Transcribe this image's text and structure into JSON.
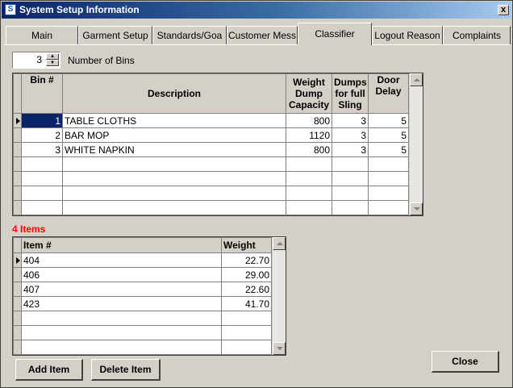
{
  "window": {
    "title": "System Setup Information",
    "app_icon": "S",
    "close_glyph": "x"
  },
  "tabs": [
    {
      "label": "Main",
      "active": false
    },
    {
      "label": "Garment Setup",
      "active": false
    },
    {
      "label": "Standards/Goa",
      "active": false
    },
    {
      "label": "Customer Mess",
      "active": false
    },
    {
      "label": "Classifier",
      "active": true
    },
    {
      "label": "Logout Reason",
      "active": false
    },
    {
      "label": "Complaints",
      "active": false
    }
  ],
  "bins": {
    "count": "3",
    "label": "Number of Bins"
  },
  "bin_table": {
    "headers": {
      "bin": "Bin #",
      "description": "Description",
      "weight": "Weight Dump Capacity",
      "dumps": "Dumps for full Sling",
      "delay": "Door Delay"
    },
    "rows": [
      {
        "bin": "1",
        "description": "TABLE CLOTHS",
        "weight": "800",
        "dumps": "3",
        "delay": "5"
      },
      {
        "bin": "2",
        "description": "BAR MOP",
        "weight": "1120",
        "dumps": "3",
        "delay": "5"
      },
      {
        "bin": "3",
        "description": "WHITE NAPKIN",
        "weight": "800",
        "dumps": "3",
        "delay": "5"
      }
    ]
  },
  "items": {
    "count_label": "4 Items",
    "headers": {
      "item": "Item #",
      "weight": "Weight"
    },
    "rows": [
      {
        "item": "404",
        "weight": "22.70"
      },
      {
        "item": "406",
        "weight": "29.00"
      },
      {
        "item": "407",
        "weight": "22.60"
      },
      {
        "item": "423",
        "weight": "41.70"
      }
    ]
  },
  "buttons": {
    "add_item": "Add Item",
    "delete_item": "Delete Item",
    "close": "Close"
  },
  "colors": {
    "face": "#d4d0c8",
    "selection": "#0a246a",
    "items_label": "#ff0000"
  }
}
